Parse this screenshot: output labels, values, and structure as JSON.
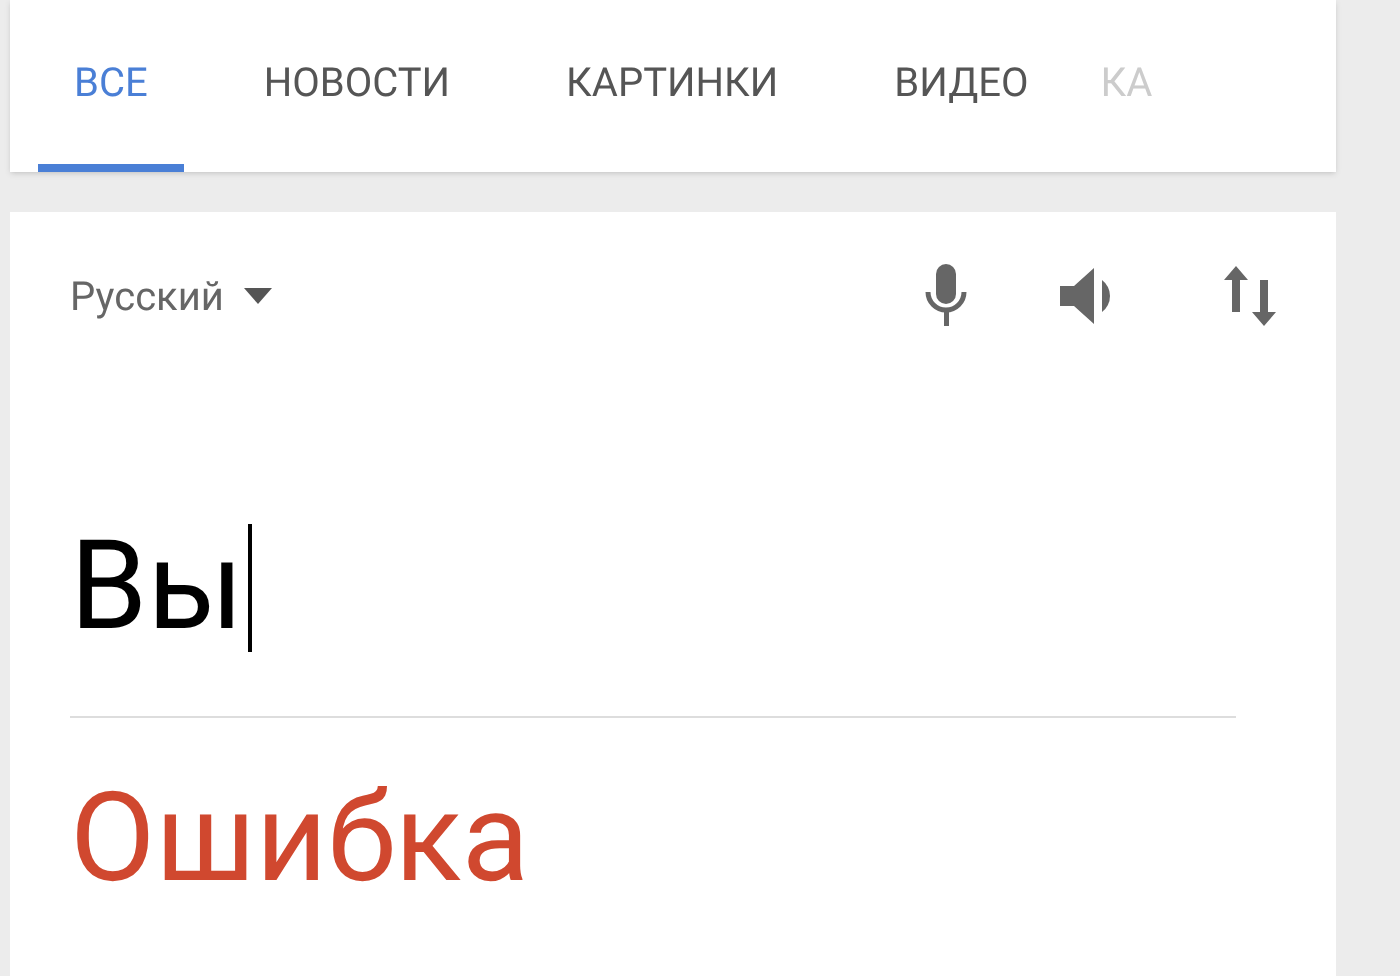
{
  "tabs": [
    {
      "label": "ВСЕ",
      "selected": true
    },
    {
      "label": "НОВОСТИ",
      "selected": false
    },
    {
      "label": "КАРТИНКИ",
      "selected": false
    },
    {
      "label": "ВИДЕО",
      "selected": false
    },
    {
      "label": "КА",
      "selected": false
    }
  ],
  "translator": {
    "language": "Русский",
    "input": "Вы",
    "result": "Ошибка"
  }
}
